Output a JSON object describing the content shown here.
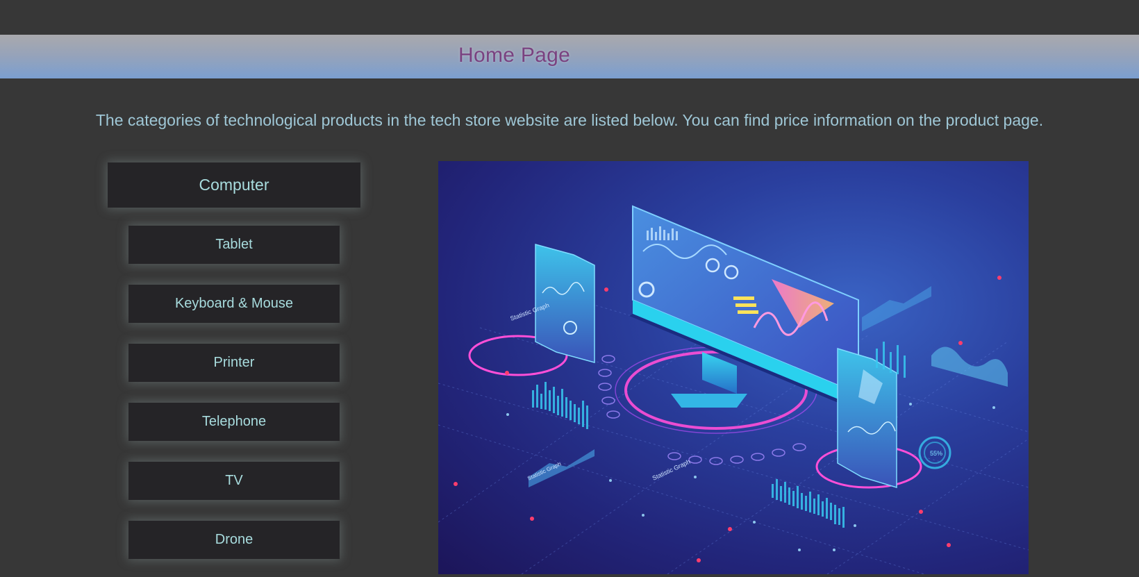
{
  "header": {
    "title": "Home Page"
  },
  "intro": {
    "text": "The categories of technological products in the tech store website are listed below. You can find price information on the product page."
  },
  "categories": [
    {
      "label": "Computer"
    },
    {
      "label": "Tablet"
    },
    {
      "label": "Keyboard & Mouse"
    },
    {
      "label": "Printer"
    },
    {
      "label": "Telephone"
    },
    {
      "label": "TV"
    },
    {
      "label": "Drone"
    }
  ],
  "hero_image": {
    "icon": "isometric-tech-devices-illustration",
    "labels": [
      "Statistic Graph",
      "Statistic Graph",
      "Statistic Graph",
      "55%"
    ]
  },
  "colors": {
    "background": "#373737",
    "title": "#7a4280",
    "intro_text": "#9fc7d6",
    "button_bg": "#252427",
    "button_text": "#a8dcde"
  }
}
